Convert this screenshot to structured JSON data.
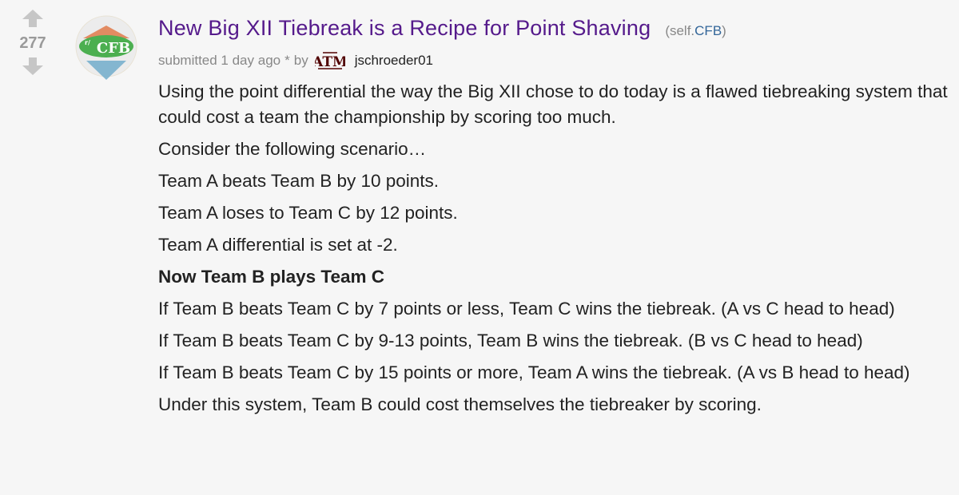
{
  "vote": {
    "score": "277"
  },
  "post": {
    "title": "New Big XII Tiebreak is a Recipe for Point Shaving",
    "domain_prefix": "(self.",
    "domain": "CFB",
    "domain_suffix": ")",
    "submitted": "submitted 1 day ago",
    "edited_marker": "*",
    "by": "by",
    "author": "jschroeder01",
    "body": [
      {
        "text": "Using the point differential the way the Big XII chose to do today is a flawed tiebreaking system that could cost a team the championship by scoring too much.",
        "bold": false
      },
      {
        "text": "Consider the following scenario…",
        "bold": false
      },
      {
        "text": "Team A beats Team B by 10 points.",
        "bold": false
      },
      {
        "text": "Team A loses to Team C by 12 points.",
        "bold": false
      },
      {
        "text": "Team A differential is set at -2.",
        "bold": false
      },
      {
        "text": "Now Team B plays Team C",
        "bold": true
      },
      {
        "text": "If Team B beats Team C by 7 points or less, Team C wins the tiebreak. (A vs C head to head)",
        "bold": false
      },
      {
        "text": "If Team B beats Team C by 9-13 points, Team B wins the tiebreak. (B vs C head to head)",
        "bold": false
      },
      {
        "text": "If Team B beats Team C by 15 points or more, Team A wins the tiebreak. (A vs B head to head)",
        "bold": false
      },
      {
        "text": "Under this system, Team B could cost themselves the tiebreaker by scoring.",
        "bold": false
      }
    ]
  },
  "thumbnail": {
    "badge": "CFB",
    "small_text": "r/"
  },
  "flair": {
    "text": "ATM"
  },
  "colors": {
    "title": "#551a8b",
    "arrow": "#c6c6c6",
    "score": "#9a9a9a",
    "flair": "#500000"
  }
}
